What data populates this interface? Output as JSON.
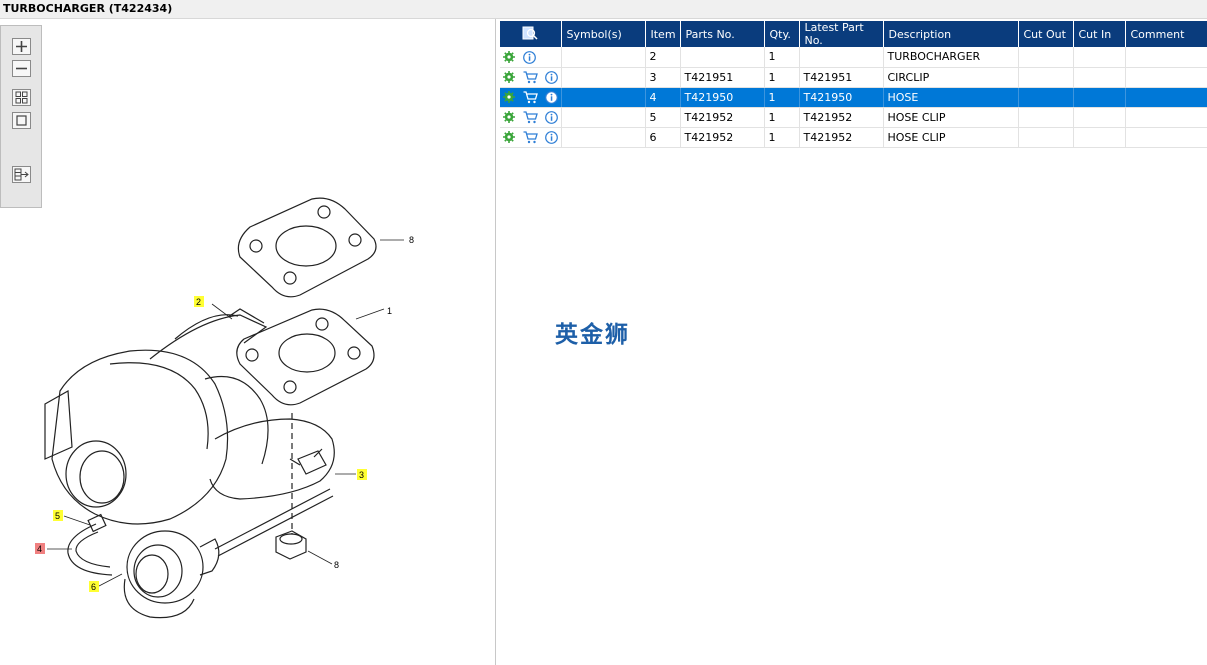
{
  "window": {
    "title": "TURBOCHARGER (T422434)"
  },
  "toolbar": {
    "zoom_in": "zoom-in-icon",
    "zoom_out": "zoom-out-icon",
    "fit": "fit-grid-icon",
    "actual": "actual-size-icon",
    "export": "export-icon"
  },
  "diagram": {
    "callouts": [
      {
        "id": "c1",
        "text": "1",
        "style": "plain"
      },
      {
        "id": "c2",
        "text": "2",
        "style": "yellow"
      },
      {
        "id": "c3",
        "text": "3",
        "style": "yellow"
      },
      {
        "id": "c4",
        "text": "4",
        "style": "red"
      },
      {
        "id": "c5",
        "text": "5",
        "style": "yellow"
      },
      {
        "id": "c6",
        "text": "6",
        "style": "yellow"
      },
      {
        "id": "c7",
        "text": "7",
        "style": "plain"
      },
      {
        "id": "c8",
        "text": "8",
        "style": "plain"
      }
    ]
  },
  "table": {
    "columns": [
      "",
      "Symbol(s)",
      "Item",
      "Parts No.",
      "Qty.",
      "Latest Part No.",
      "Description",
      "Cut Out",
      "Cut In",
      "Comment"
    ],
    "rows": [
      {
        "cart": false,
        "symbols": "",
        "item": "2",
        "part_no": "",
        "qty": "1",
        "latest": "",
        "description": "TURBOCHARGER",
        "cut_out": "",
        "cut_in": "",
        "comment": "",
        "selected": false
      },
      {
        "cart": true,
        "symbols": "",
        "item": "3",
        "part_no": "T421951",
        "qty": "1",
        "latest": "T421951",
        "description": "CIRCLIP",
        "cut_out": "",
        "cut_in": "",
        "comment": "",
        "selected": false
      },
      {
        "cart": true,
        "symbols": "",
        "item": "4",
        "part_no": "T421950",
        "qty": "1",
        "latest": "T421950",
        "description": "HOSE",
        "cut_out": "",
        "cut_in": "",
        "comment": "",
        "selected": true
      },
      {
        "cart": true,
        "symbols": "",
        "item": "5",
        "part_no": "T421952",
        "qty": "1",
        "latest": "T421952",
        "description": "HOSE CLIP",
        "cut_out": "",
        "cut_in": "",
        "comment": "",
        "selected": false
      },
      {
        "cart": true,
        "symbols": "",
        "item": "6",
        "part_no": "T421952",
        "qty": "1",
        "latest": "T421952",
        "description": "HOSE CLIP",
        "cut_out": "",
        "cut_in": "",
        "comment": "",
        "selected": false
      }
    ]
  },
  "watermark": {
    "text": "英金狮"
  },
  "colors": {
    "header_bg": "#0a3c7d",
    "selected_row": "#0078d7",
    "callout_yellow": "#ffff33",
    "callout_red": "#f08080",
    "gear_green": "#3aa53a",
    "info_blue": "#2f7fd6"
  }
}
